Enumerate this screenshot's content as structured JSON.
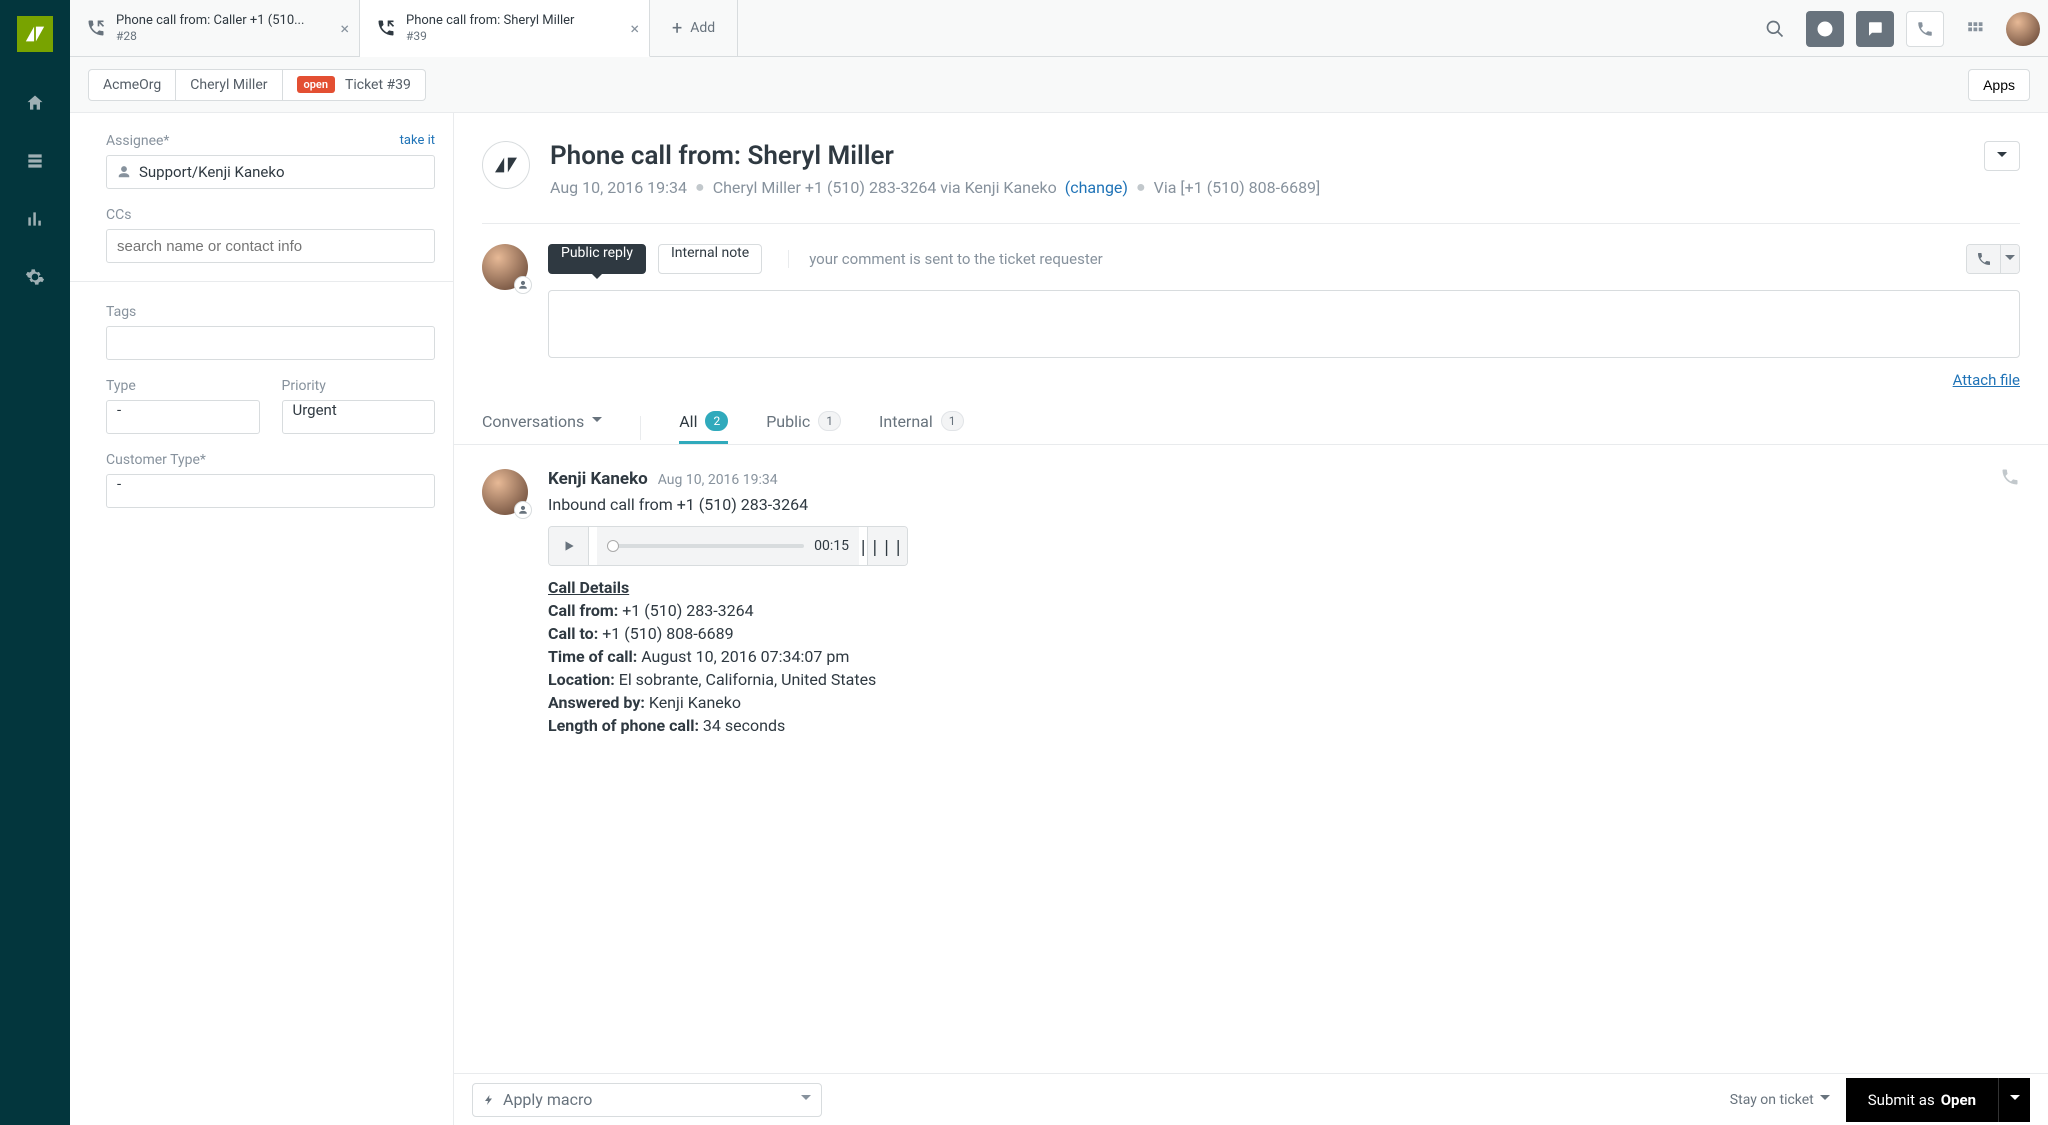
{
  "tabs": [
    {
      "title": "Phone call from: Caller +1 (510...",
      "sub": "#28"
    },
    {
      "title": "Phone call from: Sheryl Miller",
      "sub": "#39"
    }
  ],
  "add_tab_label": "Add",
  "breadcrumb": {
    "org": "AcmeOrg",
    "requester": "Cheryl Miller",
    "status_badge": "open",
    "ticket": "Ticket #39"
  },
  "apps_button": "Apps",
  "sidebar": {
    "assignee_label": "Assignee*",
    "take_it": "take it",
    "assignee_value": "Support/Kenji Kaneko",
    "cc_label": "CCs",
    "cc_placeholder": "search name or contact info",
    "tags_label": "Tags",
    "type_label": "Type",
    "type_value": "-",
    "priority_label": "Priority",
    "priority_value": "Urgent",
    "customer_type_label": "Customer Type*",
    "customer_type_value": "-"
  },
  "ticket": {
    "title": "Phone call from: Sheryl Miller",
    "timestamp": "Aug 10, 2016 19:34",
    "requester_line": "Cheryl Miller +1 (510) 283-3264 via Kenji Kaneko",
    "change": "(change)",
    "via_line": "Via [+1 (510) 808-6689]"
  },
  "compose": {
    "public_reply": "Public reply",
    "internal_note": "Internal note",
    "hint": "your comment is sent to the ticket requester",
    "attach": "Attach file"
  },
  "feed_tabs": {
    "conversations": "Conversations",
    "all": "All",
    "all_count": "2",
    "public": "Public",
    "public_count": "1",
    "internal": "Internal",
    "internal_count": "1"
  },
  "event": {
    "author": "Kenji Kaneko",
    "time": "Aug 10, 2016 19:34",
    "summary": "Inbound call from +1 (510) 283-3264",
    "play_time": "00:15",
    "details_heading": "Call Details",
    "rows": {
      "call_from_label": "Call from:",
      "call_from": "+1 (510) 283-3264",
      "call_to_label": "Call to:",
      "call_to": "+1 (510) 808-6689",
      "time_label": "Time of call:",
      "time": "August 10, 2016 07:34:07 pm",
      "location_label": "Location:",
      "location": "El sobrante, California, United States",
      "answered_by_label": "Answered by:",
      "answered_by": "Kenji Kaneko",
      "length_label": "Length of phone call:",
      "length": "34 seconds"
    }
  },
  "footer": {
    "macro": "Apply macro",
    "stay": "Stay on ticket",
    "submit_prefix": "Submit as",
    "submit_status": "Open"
  }
}
